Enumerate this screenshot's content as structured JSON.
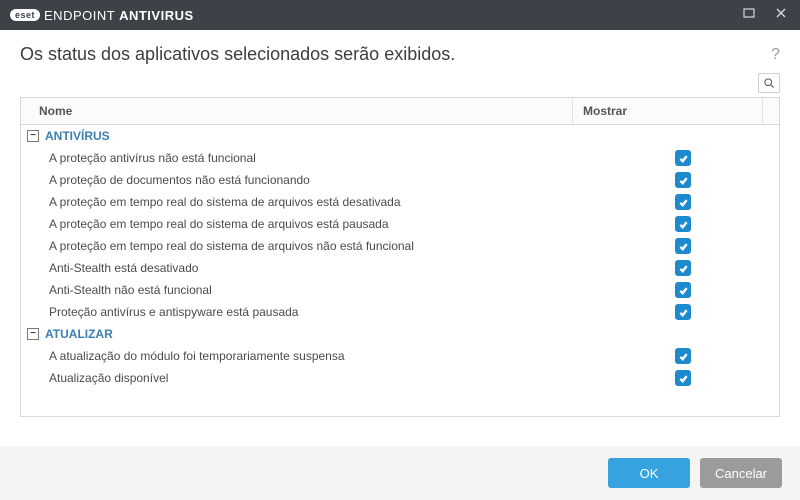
{
  "brand": {
    "badge": "eset",
    "name_light": "ENDPOINT ",
    "name_bold": "ANTIVIRUS"
  },
  "header": {
    "title": "Os status dos aplicativos selecionados serão exibidos.",
    "help": "?"
  },
  "columns": {
    "name": "Nome",
    "show": "Mostrar"
  },
  "groups": [
    {
      "label": "ANTIVÍRUS",
      "items": [
        {
          "label": "A proteção antivírus não está funcional",
          "checked": true
        },
        {
          "label": "A proteção de documentos não está funcionando",
          "checked": true
        },
        {
          "label": "A proteção em tempo real do sistema de arquivos está desativada",
          "checked": true
        },
        {
          "label": "A proteção em tempo real do sistema de arquivos está pausada",
          "checked": true
        },
        {
          "label": "A proteção em tempo real do sistema de arquivos não está funcional",
          "checked": true
        },
        {
          "label": "Anti-Stealth está desativado",
          "checked": true
        },
        {
          "label": "Anti-Stealth não está funcional",
          "checked": true
        },
        {
          "label": "Proteção antivírus e antispyware está pausada",
          "checked": true
        }
      ]
    },
    {
      "label": "ATUALIZAR",
      "items": [
        {
          "label": "A atualização do módulo foi temporariamente suspensa",
          "checked": true
        },
        {
          "label": "Atualização disponível",
          "checked": true
        }
      ]
    }
  ],
  "buttons": {
    "ok": "OK",
    "cancel": "Cancelar"
  },
  "colors": {
    "accent": "#1e89cc",
    "titlebar": "#3d4248"
  }
}
